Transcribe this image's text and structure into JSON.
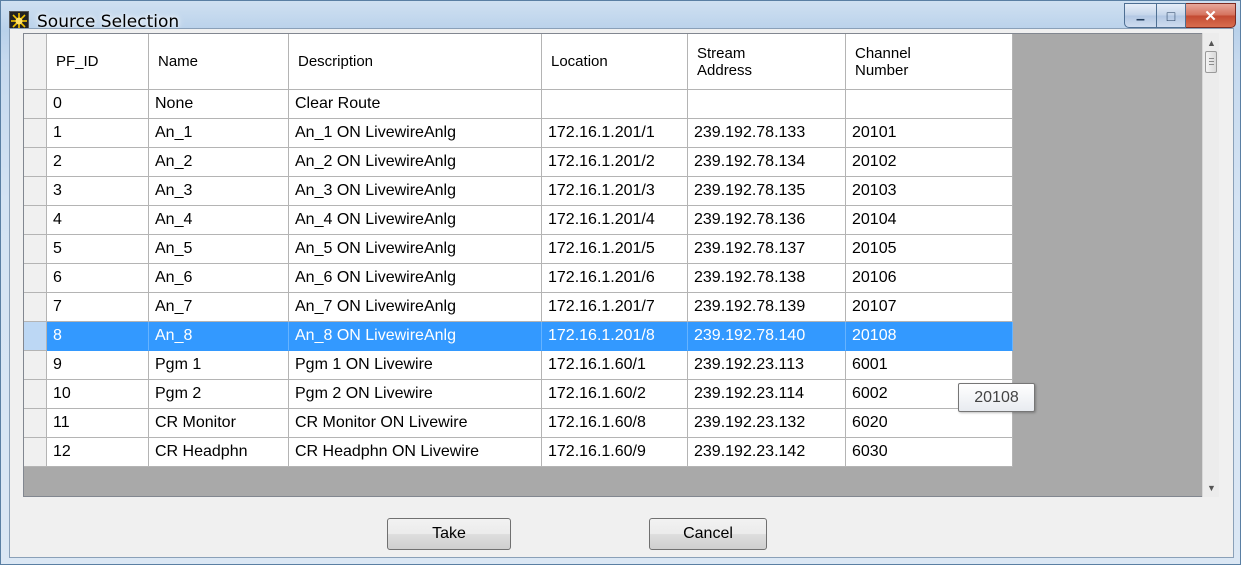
{
  "window": {
    "title": "Source Selection"
  },
  "caption": {
    "minimize_glyph": "▁",
    "maximize_glyph": "□",
    "close_glyph": "✕"
  },
  "columns": [
    "PF_ID",
    "Name",
    "Description",
    "Location",
    "Stream\nAddress",
    "Channel\nNumber"
  ],
  "rows": [
    [
      "0",
      "None",
      "Clear Route",
      "",
      "",
      ""
    ],
    [
      "1",
      "An_1",
      "An_1 ON LivewireAnlg",
      "172.16.1.201/1",
      "239.192.78.133",
      "20101"
    ],
    [
      "2",
      "An_2",
      "An_2 ON LivewireAnlg",
      "172.16.1.201/2",
      "239.192.78.134",
      "20102"
    ],
    [
      "3",
      "An_3",
      "An_3 ON LivewireAnlg",
      "172.16.1.201/3",
      "239.192.78.135",
      "20103"
    ],
    [
      "4",
      "An_4",
      "An_4 ON LivewireAnlg",
      "172.16.1.201/4",
      "239.192.78.136",
      "20104"
    ],
    [
      "5",
      "An_5",
      "An_5 ON LivewireAnlg",
      "172.16.1.201/5",
      "239.192.78.137",
      "20105"
    ],
    [
      "6",
      "An_6",
      "An_6 ON LivewireAnlg",
      "172.16.1.201/6",
      "239.192.78.138",
      "20106"
    ],
    [
      "7",
      "An_7",
      "An_7 ON LivewireAnlg",
      "172.16.1.201/7",
      "239.192.78.139",
      "20107"
    ],
    [
      "8",
      "An_8",
      "An_8 ON LivewireAnlg",
      "172.16.1.201/8",
      "239.192.78.140",
      "20108"
    ],
    [
      "9",
      "Pgm 1",
      "Pgm 1 ON Livewire",
      "172.16.1.60/1",
      "239.192.23.113",
      "6001"
    ],
    [
      "10",
      "Pgm 2",
      "Pgm 2 ON Livewire",
      "172.16.1.60/2",
      "239.192.23.114",
      "6002"
    ],
    [
      "11",
      "CR Monitor",
      "CR Monitor ON Livewire",
      "172.16.1.60/8",
      "239.192.23.132",
      "6020"
    ],
    [
      "12",
      "CR Headphn",
      "CR Headphn ON Livewire",
      "172.16.1.60/9",
      "239.192.23.142",
      "6030"
    ]
  ],
  "selected_row": 8,
  "tooltip": "20108",
  "scroll": {
    "up_glyph": "▲",
    "down_glyph": "▼"
  },
  "buttons": {
    "take": "Take",
    "cancel": "Cancel"
  },
  "colors": {
    "selection": "#3399ff",
    "grid_empty_area": "#a9a9a9",
    "close_button": "#c34a32"
  }
}
